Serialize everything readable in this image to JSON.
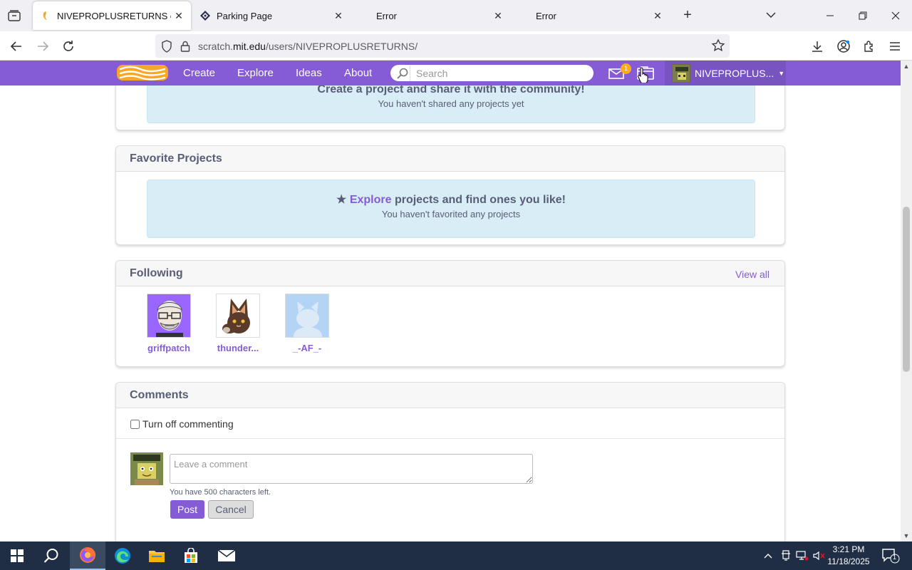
{
  "browser": {
    "tabs": [
      {
        "title": "NIVEPROPLUSRETURNS on Scratch",
        "active": true
      },
      {
        "title": "Parking Page",
        "active": false
      },
      {
        "title": "Error",
        "active": false
      },
      {
        "title": "Error",
        "active": false
      }
    ],
    "url_prefix": "scratch.",
    "url_domain": "mit.edu",
    "url_path": "/users/NIVEPROPLUSRETURNS/"
  },
  "scratch_nav": {
    "links": [
      "Create",
      "Explore",
      "Ideas",
      "About"
    ],
    "search_placeholder": "Search",
    "message_count": "1",
    "username": "NIVEPROPLUS..."
  },
  "shared_projects": {
    "cta_text": "Create a project and share it with the community!",
    "empty_text": "You haven't shared any projects yet"
  },
  "favorite_projects": {
    "heading": "Favorite Projects",
    "cta_link": "Explore",
    "cta_rest": " projects and find ones you like!",
    "empty_text": "You haven't favorited any projects"
  },
  "following": {
    "heading": "Following",
    "view_all": "View all",
    "users": [
      {
        "name": "griffpatch"
      },
      {
        "name": "thunder..."
      },
      {
        "name": "_-AF_-"
      }
    ]
  },
  "comments": {
    "heading": "Comments",
    "turn_off_label": "Turn off commenting",
    "placeholder": "Leave a comment",
    "chars_left": "You have 500 characters left.",
    "post_label": "Post",
    "cancel_label": "Cancel"
  },
  "taskbar": {
    "time": "3:21 PM",
    "date": "11/18/2025",
    "notification_count": "1"
  },
  "colors": {
    "scratch_purple": "#855cd6",
    "empty_box_bg": "#d9edf7",
    "badge_orange": "#ffab1a",
    "taskbar_bg": "#1f2e44"
  }
}
